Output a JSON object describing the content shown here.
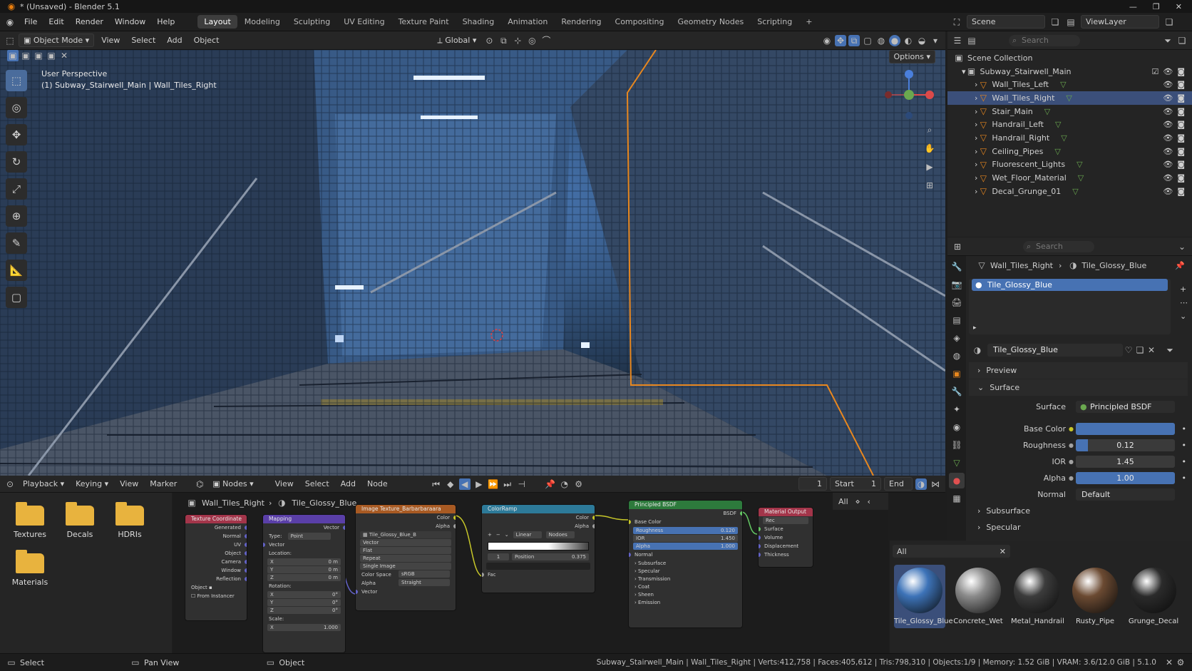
{
  "window": {
    "title": "* (Unsaved) - Blender 5.1"
  },
  "menu": [
    "File",
    "Edit",
    "Render",
    "Window",
    "Help"
  ],
  "workspaces": [
    "Layout",
    "Modeling",
    "Sculpting",
    "UV Editing",
    "Texture Paint",
    "Shading",
    "Animation",
    "Rendering",
    "Compositing",
    "Geometry Nodes",
    "Scripting"
  ],
  "active_workspace": "Layout",
  "scene": {
    "label": "Scene",
    "view_layer": "ViewLayer"
  },
  "viewport_header": {
    "mode": "Object Mode",
    "menus": [
      "View",
      "Select",
      "Add",
      "Object"
    ],
    "transform": "Global",
    "options": "Options"
  },
  "viewport": {
    "perspective": "User Perspective",
    "context": "(1) Subway_Stairwell_Main | Wall_Tiles_Right"
  },
  "outliner": {
    "search_placeholder": "Search",
    "root": "Scene Collection",
    "collection": "Subway_Stairwell_Main",
    "items": [
      "Wall_Tiles_Left",
      "Wall_Tiles_Right",
      "Stair_Main",
      "Handrail_Left",
      "Handrail_Right",
      "Ceiling_Pipes",
      "Fluorescent_Lights",
      "Wet_Floor_Material",
      "Decal_Grunge_01"
    ],
    "selected": "Wall_Tiles_Right"
  },
  "properties": {
    "search_placeholder": "Search",
    "breadcrumb_object": "Wall_Tiles_Right",
    "breadcrumb_material": "Tile_Glossy_Blue",
    "slot": "Tile_Glossy_Blue",
    "material_name": "Tile_Glossy_Blue",
    "panels": {
      "preview": "Preview",
      "surface": "Surface",
      "subsurface": "Subsurface",
      "specular": "Specular"
    },
    "surface_label": "Surface",
    "surface_value": "Principled BSDF",
    "fields": [
      {
        "label": "Base Color",
        "value": "",
        "fill": 1.0,
        "color": "#4772b3"
      },
      {
        "label": "Roughness",
        "value": "0.12",
        "fill": 0.12,
        "color": "#4772b3"
      },
      {
        "label": "IOR",
        "value": "1.45",
        "fill": 0.0,
        "color": "#4772b3"
      },
      {
        "label": "Alpha",
        "value": "1.00",
        "fill": 1.0,
        "color": "#4772b3"
      }
    ],
    "normal_label": "Normal",
    "normal_value": "Default"
  },
  "timeline": {
    "menus": [
      "Playback",
      "Keying",
      "View",
      "Marker"
    ],
    "frame": "1",
    "start_label": "Start",
    "start": "1",
    "end_label": "End"
  },
  "node_editor": {
    "type": "Nodes",
    "menus": [
      "View",
      "Select",
      "Add",
      "Node"
    ],
    "breadcrumb_object": "Wall_Tiles_Right",
    "breadcrumb_material": "Tile_Glossy_Blue",
    "filter": "All",
    "nodes": {
      "texcoord": {
        "title": "Texture Coordinate",
        "outputs": [
          "Generated",
          "Normal",
          "UV",
          "Object",
          "Camera",
          "Window",
          "Reflection"
        ],
        "object_label": "Object",
        "instancer": "From Instancer"
      },
      "mapping": {
        "title": "Mapping",
        "out": "Vector",
        "type_label": "Type:",
        "type_value": "Point",
        "vector": "Vector",
        "location": "Location:",
        "loc": [
          [
            "X",
            "0 m"
          ],
          [
            "Y",
            "0 m"
          ],
          [
            "Z",
            "0 m"
          ]
        ],
        "rotation": "Rotation:",
        "rot": [
          [
            "X",
            "0°"
          ],
          [
            "Y",
            "0°"
          ],
          [
            "Z",
            "0°"
          ]
        ],
        "scale": "Scale:",
        "scale_x": [
          "X",
          "1.000"
        ]
      },
      "image": {
        "title": "Image Texture_Barbarbaraara",
        "outputs": [
          "Color",
          "Alpha"
        ],
        "image_name": "Tile_Glossy_Blue_B",
        "dropdowns": [
          "Vector",
          "Flat",
          "Repeat",
          "Single Image"
        ],
        "color_space_label": "Color Space",
        "color_space": "sRGB",
        "alpha_label": "Alpha",
        "alpha": "Straight",
        "input": "Vector"
      },
      "ramp": {
        "title": "ColorRamp",
        "outputs": [
          "Color",
          "Alpha"
        ],
        "interp": "Linear",
        "mode": "Nodoes",
        "index": "1",
        "pos_label": "Position",
        "pos_value": "0.375",
        "input": "Fac"
      },
      "bsdf": {
        "title": "Principled BSDF",
        "out": "BSDF",
        "base": "Base Color",
        "fields": [
          [
            "Roughness",
            "0.120"
          ],
          [
            "IOR",
            "1.450"
          ],
          [
            "Alpha",
            "1.000"
          ]
        ],
        "normal": "Normal",
        "sections": [
          "Subsurface",
          "Specular",
          "Transmission",
          "Coat",
          "Sheen",
          "Emission"
        ]
      },
      "output": {
        "title": "Material Output",
        "target": "Rec",
        "inputs": [
          "Surface",
          "Volume",
          "Displacement",
          "Thickness"
        ]
      }
    }
  },
  "file_browser": {
    "folders": [
      "Textures",
      "Decals",
      "HDRIs",
      "Materials"
    ]
  },
  "asset_browser": {
    "filter": "All",
    "assets": [
      {
        "name": "Tile_Glossy_Blue",
        "color": "#3d73b8"
      },
      {
        "name": "Concrete_Wet",
        "color": "#8a8a8a"
      },
      {
        "name": "Metal_Handrail",
        "color": "#3c3c3c"
      },
      {
        "name": "Rusty_Pipe",
        "color": "#6b4a32"
      },
      {
        "name": "Grunge_Decal",
        "color": "#2b2b2b"
      }
    ],
    "selected": "Tile_Glossy_Blue"
  },
  "status": {
    "left": "Select",
    "middle": "Pan View",
    "right_action": "Object",
    "stats": "Subway_Stairwell_Main | Wall_Tiles_Right | Verts:412,758 | Faces:405,612 | Tris:798,310 | Objects:1/9 | Memory: 1.52 GiB | VRAM: 3.6/12.0 GiB | 5.1.0"
  },
  "colors": {
    "accent": "#4772b3",
    "selection": "#e8871e",
    "folder": "#e8b33e"
  }
}
